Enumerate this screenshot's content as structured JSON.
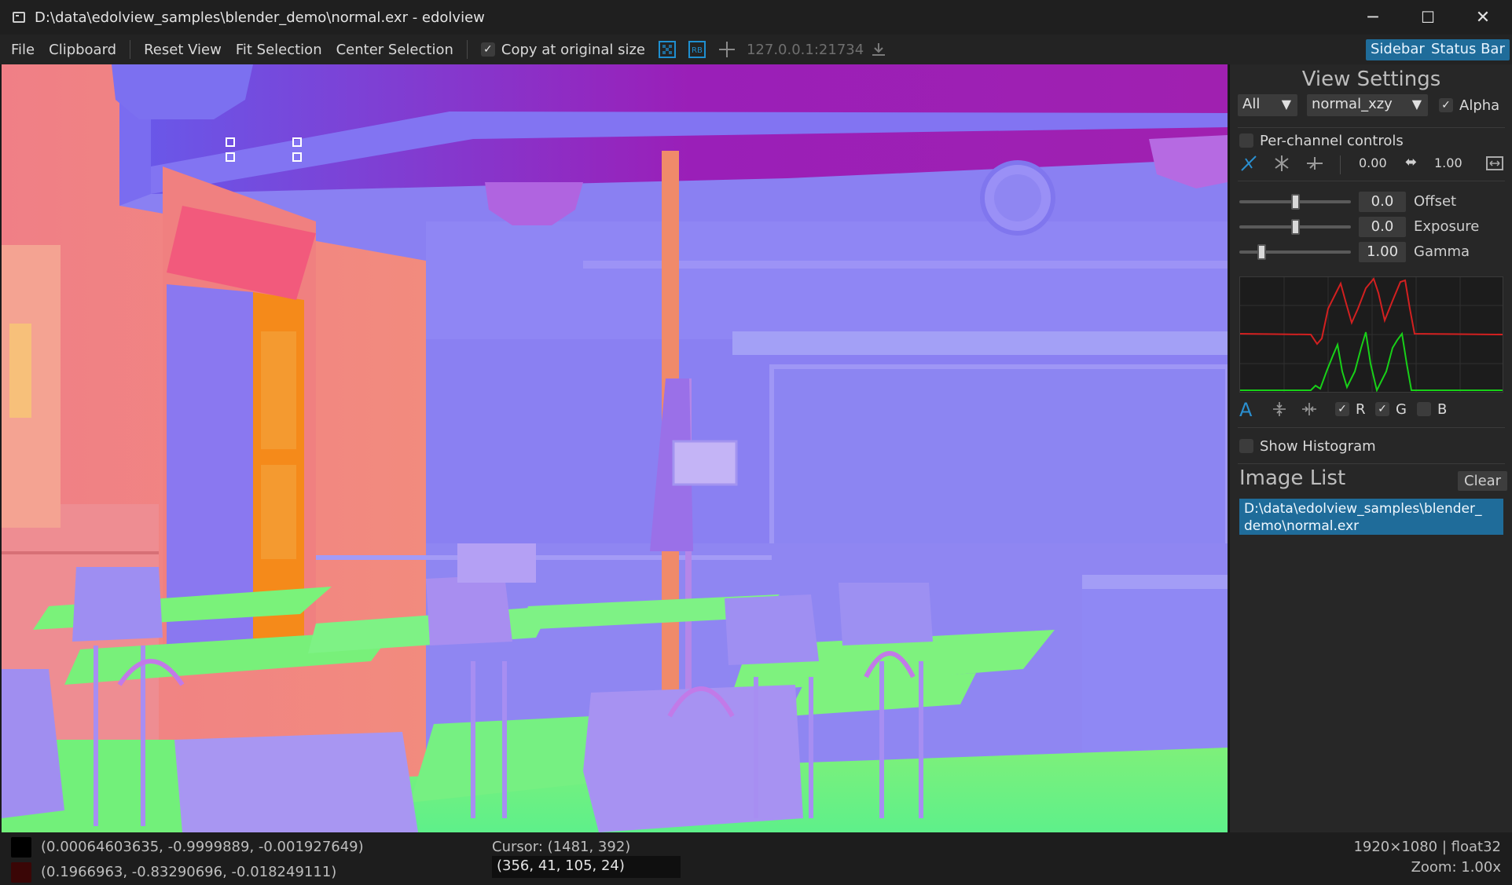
{
  "window": {
    "title": "D:\\data\\edolview_samples\\blender_demo\\normal.exr - edolview",
    "minimize": "─",
    "maximize": "☐",
    "close": "✕"
  },
  "menu": {
    "file": "File",
    "clipboard": "Clipboard",
    "reset_view": "Reset View",
    "fit_selection": "Fit Selection",
    "center_selection": "Center Selection",
    "copy_original_checkbox": "✓",
    "copy_original_label": "Copy at original size",
    "server_address": "127.0.0.1:21734",
    "sidebar_toggle": "Sidebar",
    "statusbar_toggle": "Status Bar"
  },
  "sidebar": {
    "view_settings_title": "View Settings",
    "channel_combo": "All",
    "colormap_combo": "normal_xzy",
    "alpha_check": "✓",
    "alpha_label": "Alpha",
    "per_channel_label": "Per-channel controls",
    "range_min": "0.00",
    "range_max": "1.00",
    "offset_value": "0.0",
    "offset_label": "Offset",
    "exposure_value": "0.0",
    "exposure_label": "Exposure",
    "gamma_value": "1.00",
    "gamma_label": "Gamma",
    "r_check": "✓",
    "r_label": "R",
    "g_check": "✓",
    "g_label": "G",
    "b_label": "B",
    "show_histogram_label": "Show Histogram",
    "image_list_title": "Image List",
    "clear_button": "Clear",
    "image_list_item": "D:\\data\\edolview_samples\\blender_ demo\\normal.exr"
  },
  "sliders": {
    "offset": 0.5,
    "exposure": 0.5,
    "gamma": 0.2
  },
  "statusbar": {
    "pixel_value_1": "(0.00064603635, -0.9999889, -0.001927649)",
    "pixel_value_2": "(0.1966963, -0.83290696, -0.018249111)",
    "cursor": "Cursor: (1481, 392)",
    "rgb_value": "(356, 41, 105, 24)",
    "image_info": "1920×1080 | float32",
    "zoom": "Zoom: 1.00x",
    "swatch_1_color": "#000000",
    "swatch_2_color": "#3a0606"
  },
  "colors": {
    "accent": "#1f6c9a",
    "background": "#1b1b1b"
  }
}
